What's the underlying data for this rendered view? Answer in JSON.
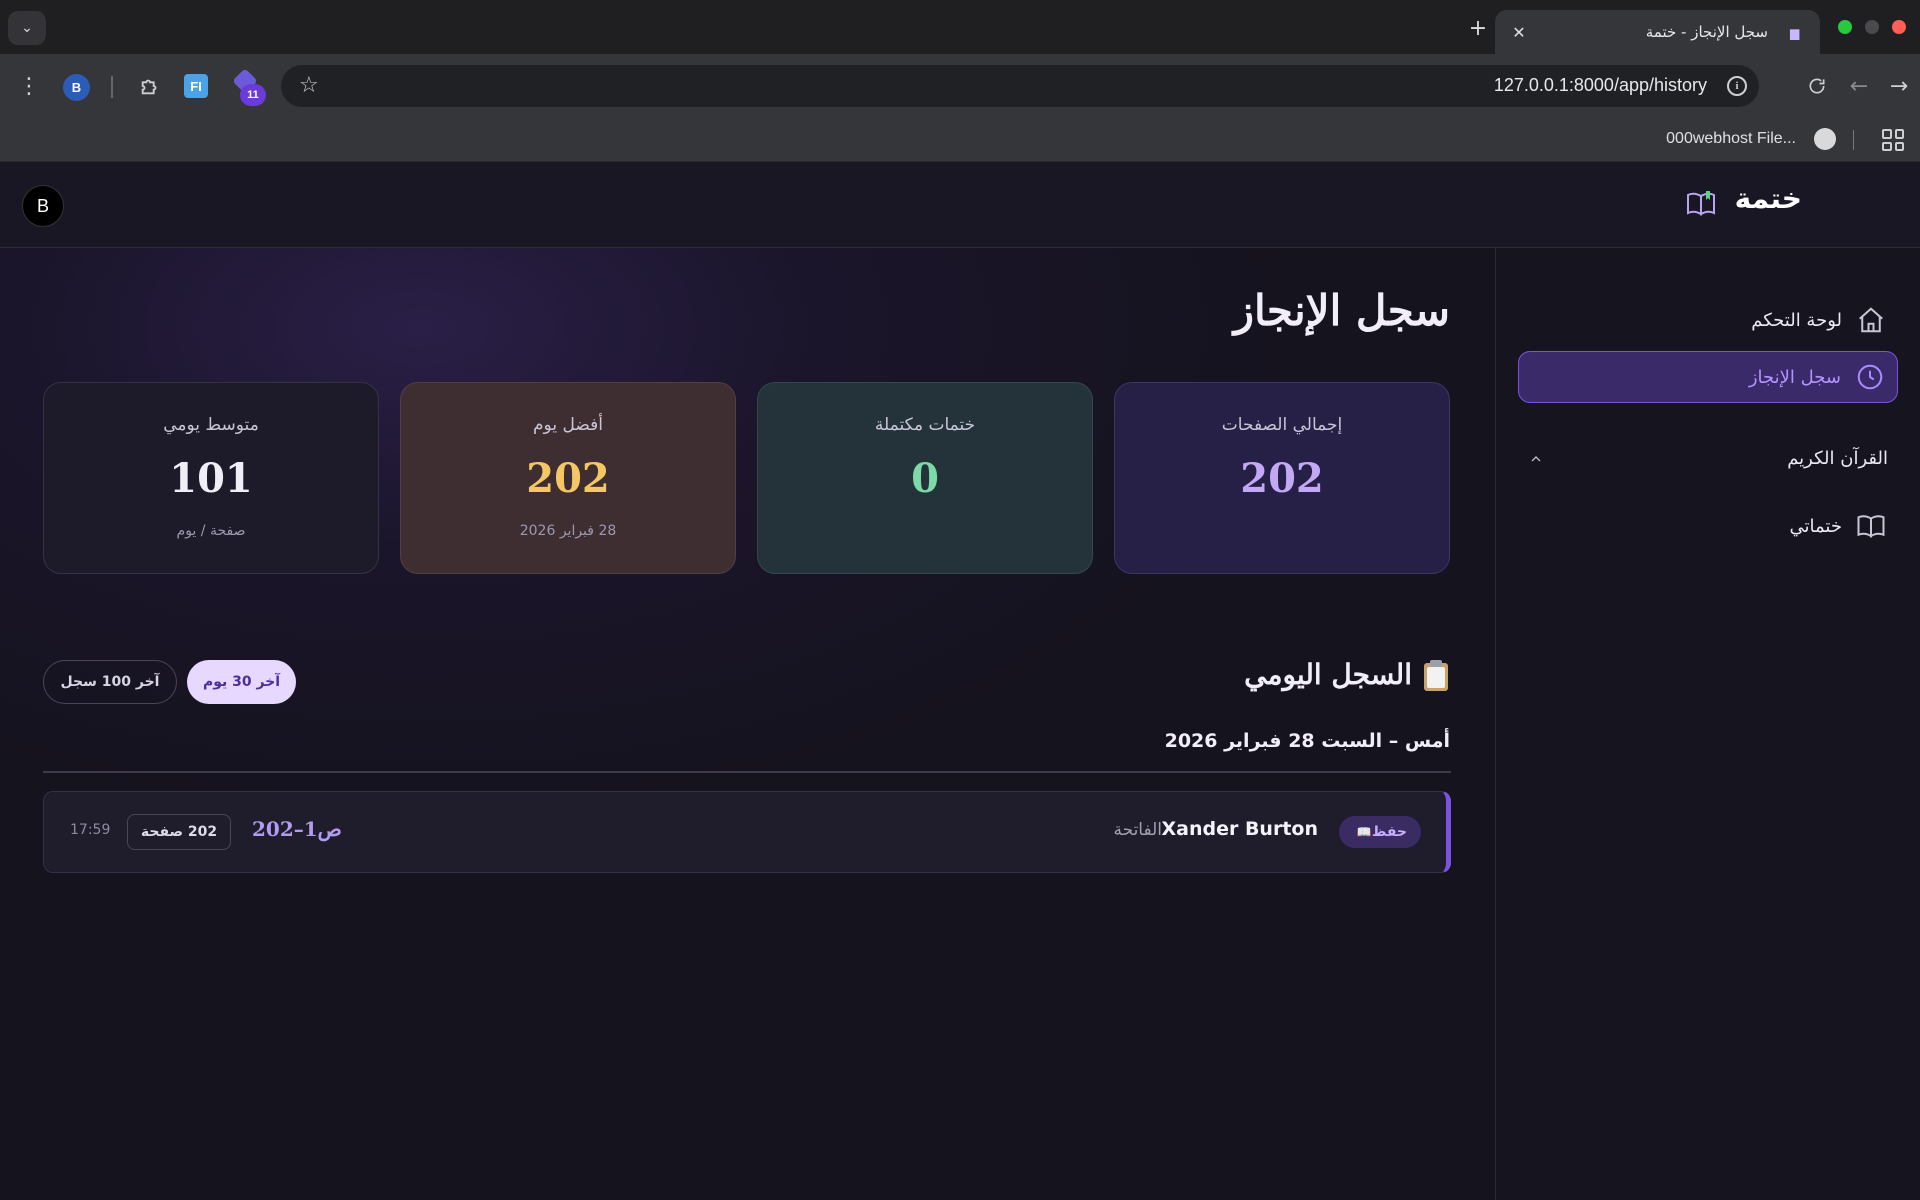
{
  "browser": {
    "tab_title": "سجل الإنجاز - ختمة",
    "tab_close": "✕",
    "new_tab": "+",
    "tab_menu": "⌄",
    "url": "127.0.0.1:8000/app/history",
    "bookmark_item": "000webhost File...",
    "extensions": {
      "profile_letter": "B",
      "fi_label": "FI",
      "badge_count": "11"
    }
  },
  "header": {
    "brand": "ختمة",
    "avatar_letter": "B"
  },
  "sidebar": {
    "items": [
      {
        "label": "لوحة التحكم",
        "icon": "home-icon",
        "active": false
      },
      {
        "label": "سجل الإنجاز",
        "icon": "clock-icon",
        "active": true
      }
    ],
    "section": {
      "label": "القرآن الكريم",
      "expanded": true
    },
    "section_items": [
      {
        "label": "ختماتي",
        "icon": "book-open-icon"
      }
    ]
  },
  "main": {
    "title": "سجل الإنجاز",
    "stats": {
      "total": {
        "label": "إجمالي الصفحات",
        "value": "202",
        "sub": ""
      },
      "completed": {
        "label": "ختمات مكتملة",
        "value": "0",
        "sub": ""
      },
      "best": {
        "label": "أفضل يوم",
        "value": "202",
        "sub": "28 فبراير 2026"
      },
      "avg": {
        "label": "متوسط يومي",
        "value": "101",
        "sub": "صفحة / يوم"
      }
    },
    "log_title": "السجل اليومي",
    "filters": {
      "last30": "آخر 30 يوم",
      "last100": "آخر 100 سجل",
      "active": "last30"
    },
    "day_heading": "أمس – السبت 28 فبراير 2026",
    "entries": [
      {
        "badge": "حفظ",
        "name": "Xander Burton",
        "surah": "الفاتحة",
        "range": "ص1–202",
        "pages": "202 صفحة",
        "time": "17:59"
      }
    ]
  },
  "colors": {
    "accent": "#7a54e0",
    "accent_text": "#b393ff",
    "total_value": "#c3a8f5",
    "completed_value": "#7ed9a8",
    "best_value": "#f5c664"
  }
}
